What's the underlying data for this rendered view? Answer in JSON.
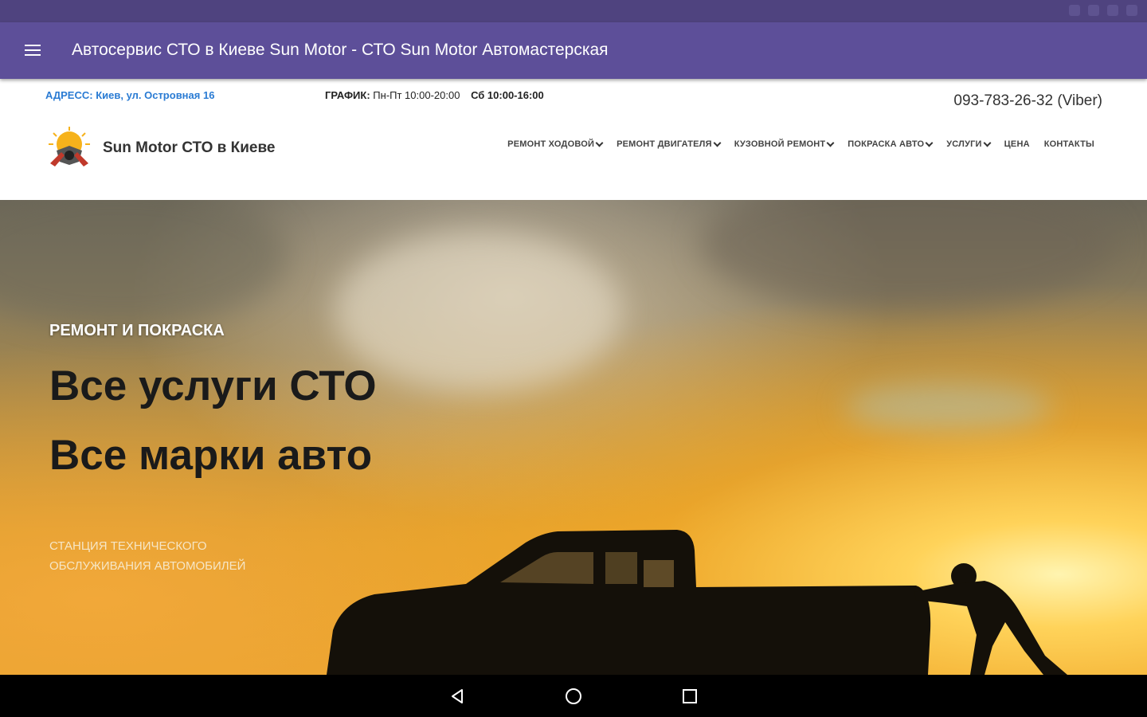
{
  "app_bar": {
    "title": "Автосервис СТО в Киеве Sun Motor - СТО Sun Motor Автомастерская"
  },
  "header": {
    "address": "АДРЕСС: Киев, ул. Островная 16",
    "schedule_label": "ГРАФИК:",
    "schedule_weekdays": "Пн-Пт 10:00-20:00",
    "schedule_saturday": "Сб 10:00-16:00",
    "phone": "093-783-26-32 (Viber)"
  },
  "logo": {
    "text": "Sun Motor СТО в Киеве"
  },
  "nav": {
    "items": [
      {
        "label": "РЕМОНТ ХОДОВОЙ",
        "has_dropdown": true
      },
      {
        "label": "РЕМОНТ ДВИГАТЕЛЯ",
        "has_dropdown": true
      },
      {
        "label": "КУЗОВНОЙ РЕМОНТ",
        "has_dropdown": true
      },
      {
        "label": "ПОКРАСКА АВТО",
        "has_dropdown": true
      },
      {
        "label": "УСЛУГИ",
        "has_dropdown": true
      },
      {
        "label": "ЦЕНА",
        "has_dropdown": false
      },
      {
        "label": "КОНТАКТЫ",
        "has_dropdown": false
      }
    ]
  },
  "hero": {
    "kicker": "РЕМОНТ И ПОКРАСКА",
    "title_line1": "Все услуги СТО",
    "title_line2": "Все марки авто",
    "subtitle": "СТАНЦИЯ ТЕХНИЧЕСКОГО ОБСЛУЖИВАНИЯ АВТОМОБИЛЕЙ"
  },
  "colors": {
    "status_bar": "#4f437f",
    "app_bar": "#5d4f99",
    "address_link": "#2a7bd3"
  },
  "system_nav": {
    "icons": [
      "back-icon",
      "home-icon",
      "recents-icon"
    ]
  }
}
